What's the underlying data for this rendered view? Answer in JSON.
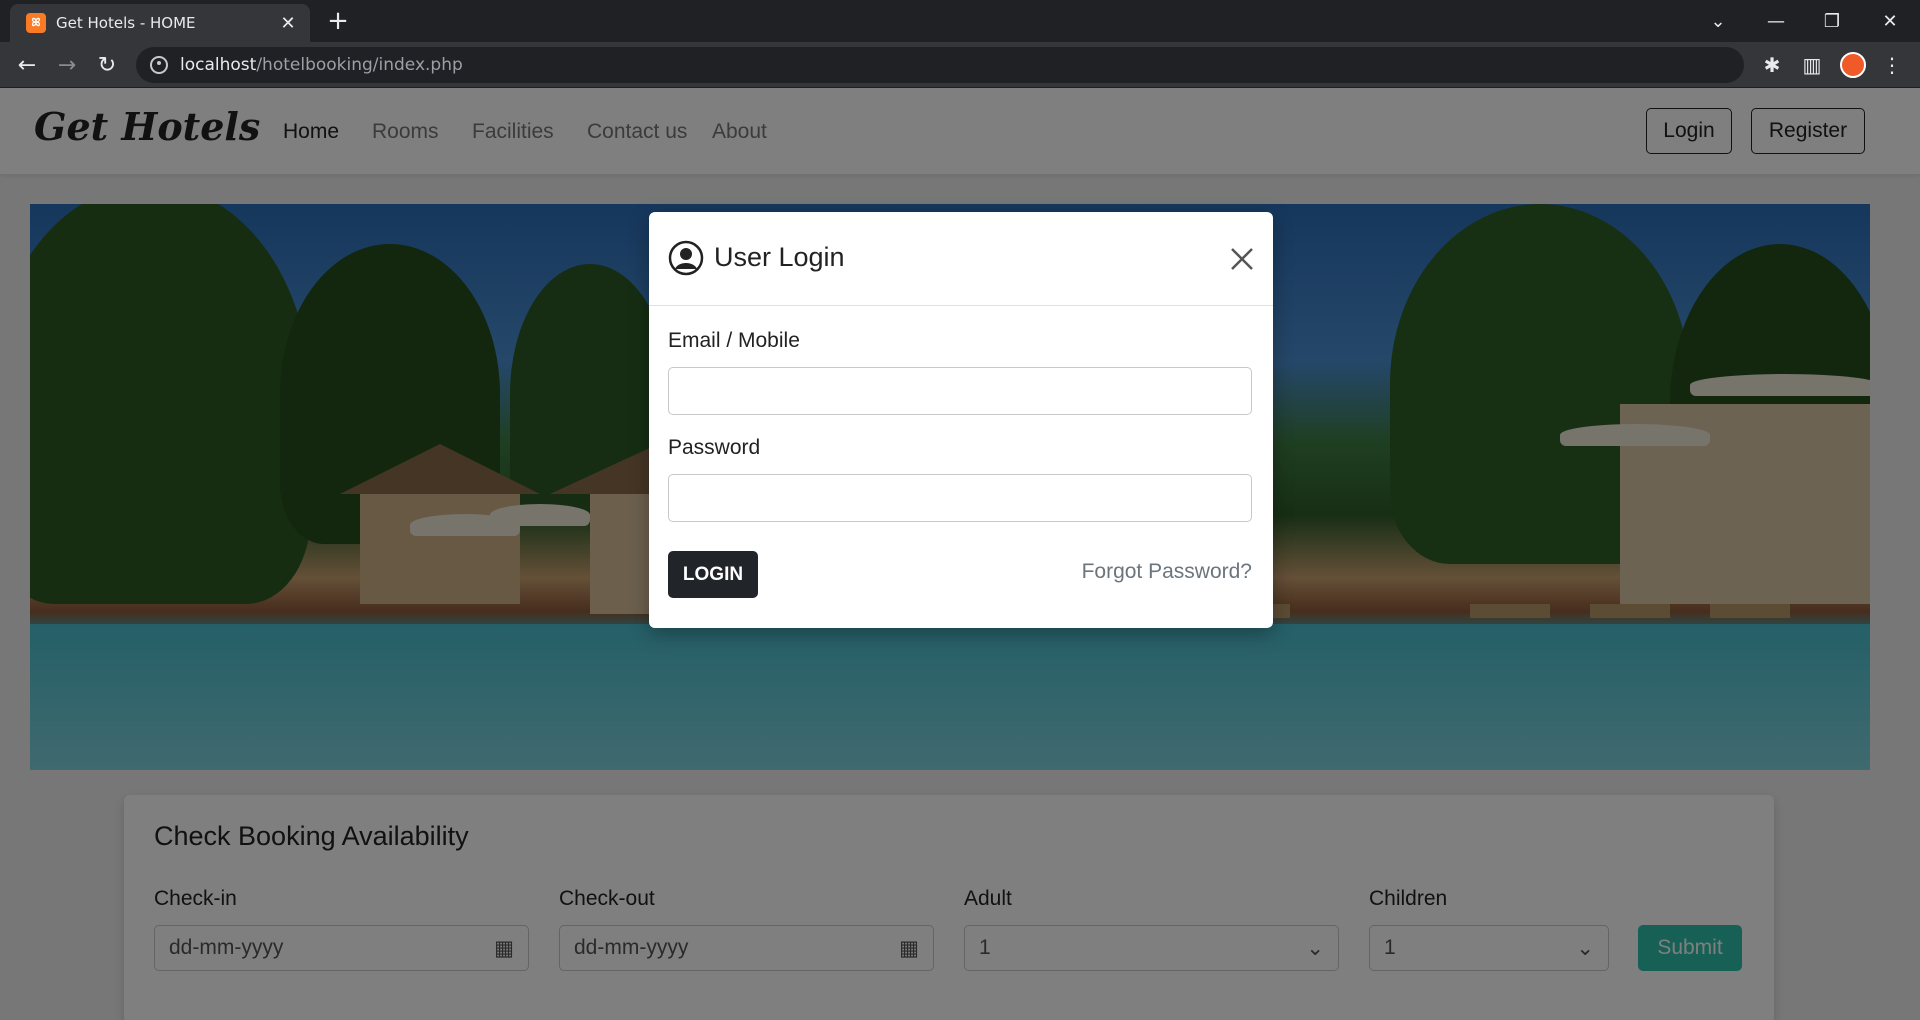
{
  "browser": {
    "tab_title": "Get Hotels - HOME",
    "tab_favicon": "XAMPP",
    "url_host": "localhost",
    "url_path": "/hotelbooking/index.php"
  },
  "navbar": {
    "brand": "Get Hotels",
    "links": [
      "Home",
      "Rooms",
      "Facilities",
      "Contact us",
      "About"
    ],
    "login_label": "Login",
    "register_label": "Register"
  },
  "booking": {
    "title": "Check Booking Availability",
    "checkin_label": "Check-in",
    "checkin_placeholder": "dd-mm-yyyy",
    "checkout_label": "Check-out",
    "checkout_placeholder": "dd-mm-yyyy",
    "adult_label": "Adult",
    "adult_value": "1",
    "children_label": "Children",
    "children_value": "1",
    "submit_label": "Submit"
  },
  "modal": {
    "title": "User Login",
    "email_label": "Email / Mobile",
    "email_value": "",
    "password_label": "Password",
    "password_value": "",
    "login_label": "LOGIN",
    "forgot_label": "Forgot Password?"
  },
  "colors": {
    "accent": "#2ec1ac",
    "dark_button": "#212529",
    "overlay": "rgba(0,0,0,0.5)"
  }
}
